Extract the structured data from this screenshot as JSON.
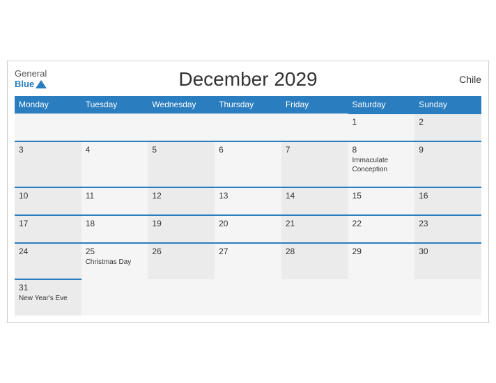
{
  "header": {
    "title": "December 2029",
    "country": "Chile",
    "logo_general": "General",
    "logo_blue": "Blue"
  },
  "days_of_week": [
    "Monday",
    "Tuesday",
    "Wednesday",
    "Thursday",
    "Friday",
    "Saturday",
    "Sunday"
  ],
  "weeks": [
    {
      "days": [
        {
          "date": "",
          "event": ""
        },
        {
          "date": "",
          "event": ""
        },
        {
          "date": "",
          "event": ""
        },
        {
          "date": "",
          "event": ""
        },
        {
          "date": "",
          "event": ""
        },
        {
          "date": "1",
          "event": ""
        },
        {
          "date": "2",
          "event": ""
        }
      ]
    },
    {
      "days": [
        {
          "date": "3",
          "event": ""
        },
        {
          "date": "4",
          "event": ""
        },
        {
          "date": "5",
          "event": ""
        },
        {
          "date": "6",
          "event": ""
        },
        {
          "date": "7",
          "event": ""
        },
        {
          "date": "8",
          "event": "Immaculate Conception"
        },
        {
          "date": "9",
          "event": ""
        }
      ]
    },
    {
      "days": [
        {
          "date": "10",
          "event": ""
        },
        {
          "date": "11",
          "event": ""
        },
        {
          "date": "12",
          "event": ""
        },
        {
          "date": "13",
          "event": ""
        },
        {
          "date": "14",
          "event": ""
        },
        {
          "date": "15",
          "event": ""
        },
        {
          "date": "16",
          "event": ""
        }
      ]
    },
    {
      "days": [
        {
          "date": "17",
          "event": ""
        },
        {
          "date": "18",
          "event": ""
        },
        {
          "date": "19",
          "event": ""
        },
        {
          "date": "20",
          "event": ""
        },
        {
          "date": "21",
          "event": ""
        },
        {
          "date": "22",
          "event": ""
        },
        {
          "date": "23",
          "event": ""
        }
      ]
    },
    {
      "days": [
        {
          "date": "24",
          "event": ""
        },
        {
          "date": "25",
          "event": "Christmas Day"
        },
        {
          "date": "26",
          "event": ""
        },
        {
          "date": "27",
          "event": ""
        },
        {
          "date": "28",
          "event": ""
        },
        {
          "date": "29",
          "event": ""
        },
        {
          "date": "30",
          "event": ""
        }
      ]
    },
    {
      "days": [
        {
          "date": "31",
          "event": "New Year's Eve"
        },
        {
          "date": "",
          "event": ""
        },
        {
          "date": "",
          "event": ""
        },
        {
          "date": "",
          "event": ""
        },
        {
          "date": "",
          "event": ""
        },
        {
          "date": "",
          "event": ""
        },
        {
          "date": "",
          "event": ""
        }
      ]
    }
  ]
}
